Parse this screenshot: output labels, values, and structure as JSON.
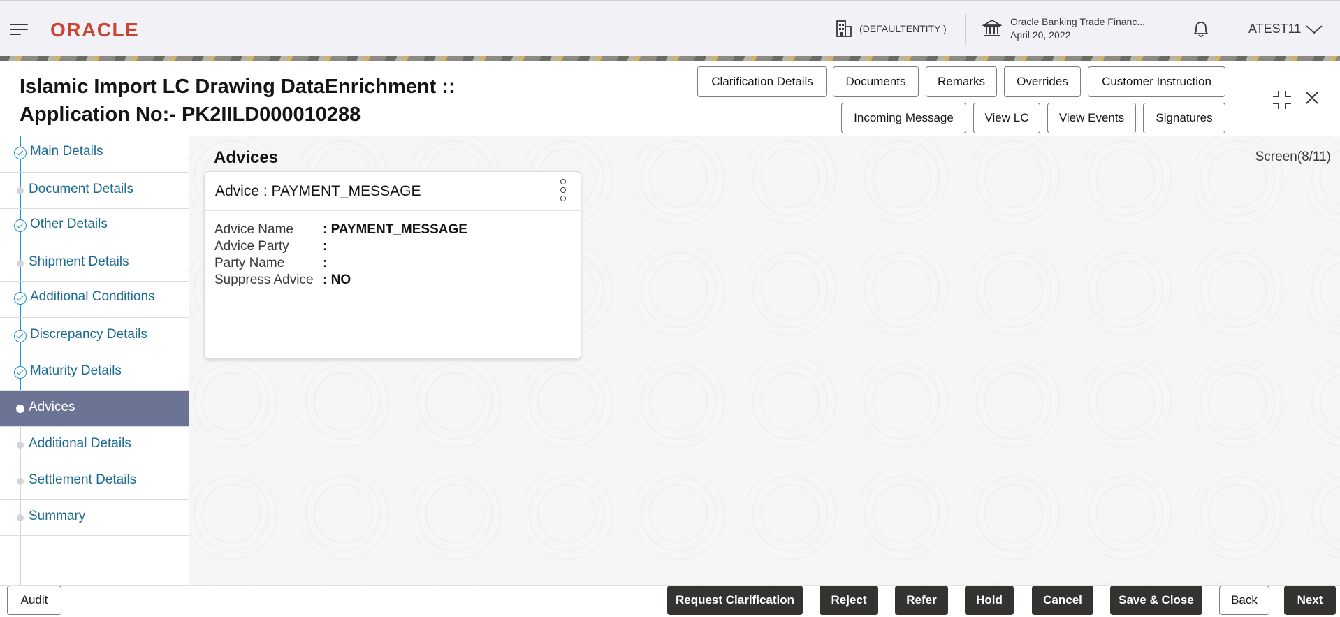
{
  "header": {
    "logo_text": "ORACLE",
    "entity": "(DEFAULTENTITY )",
    "app_name": "Oracle Banking Trade Financ...",
    "app_date": "April 20, 2022",
    "user": "ATEST11"
  },
  "title": {
    "line1": "Islamic Import LC Drawing DataEnrichment ::",
    "line2": "Application No:- PK2IILD000010288"
  },
  "toolbar": {
    "clarification_details": "Clarification Details",
    "documents": "Documents",
    "remarks": "Remarks",
    "overrides": "Overrides",
    "customer_instruction": "Customer Instruction",
    "incoming_message": "Incoming Message",
    "view_lc": "View LC",
    "view_events": "View Events",
    "signatures": "Signatures"
  },
  "nav": {
    "items": [
      {
        "label": "Main Details",
        "state": "done"
      },
      {
        "label": "Document Details",
        "state": "pending"
      },
      {
        "label": "Other Details",
        "state": "done"
      },
      {
        "label": "Shipment Details",
        "state": "pending"
      },
      {
        "label": "Additional Conditions",
        "state": "done"
      },
      {
        "label": "Discrepancy Details",
        "state": "done"
      },
      {
        "label": "Maturity Details",
        "state": "done"
      },
      {
        "label": "Advices",
        "state": "active"
      },
      {
        "label": "Additional Details",
        "state": "pending"
      },
      {
        "label": "Settlement Details",
        "state": "pending"
      },
      {
        "label": "Summary",
        "state": "pending"
      }
    ]
  },
  "main": {
    "section_title": "Advices",
    "screen_count": "Screen(8/11)",
    "card": {
      "title": "Advice : PAYMENT_MESSAGE",
      "fields": [
        {
          "key": "Advice Name",
          "value": ": PAYMENT_MESSAGE"
        },
        {
          "key": "Advice Party",
          "value": ":"
        },
        {
          "key": "Party Name",
          "value": ":"
        },
        {
          "key": "Suppress Advice",
          "value": ": NO"
        }
      ]
    }
  },
  "footer": {
    "audit": "Audit",
    "request_clarification": "Request Clarification",
    "reject": "Reject",
    "refer": "Refer",
    "hold": "Hold",
    "cancel": "Cancel",
    "save_close": "Save & Close",
    "back": "Back",
    "next": "Next"
  },
  "colors": {
    "brand_red": "#c74634",
    "nav_link": "#1c6b93",
    "nav_active_bg": "#6b7495",
    "progress_blue": "#1c8fcf",
    "dark_button": "#34332f"
  },
  "icons": [
    "hamburger-icon",
    "building-icon",
    "bank-icon",
    "bell-icon",
    "chevron-down-icon",
    "maximize-icon",
    "close-icon",
    "kebab-icon",
    "check-icon"
  ]
}
